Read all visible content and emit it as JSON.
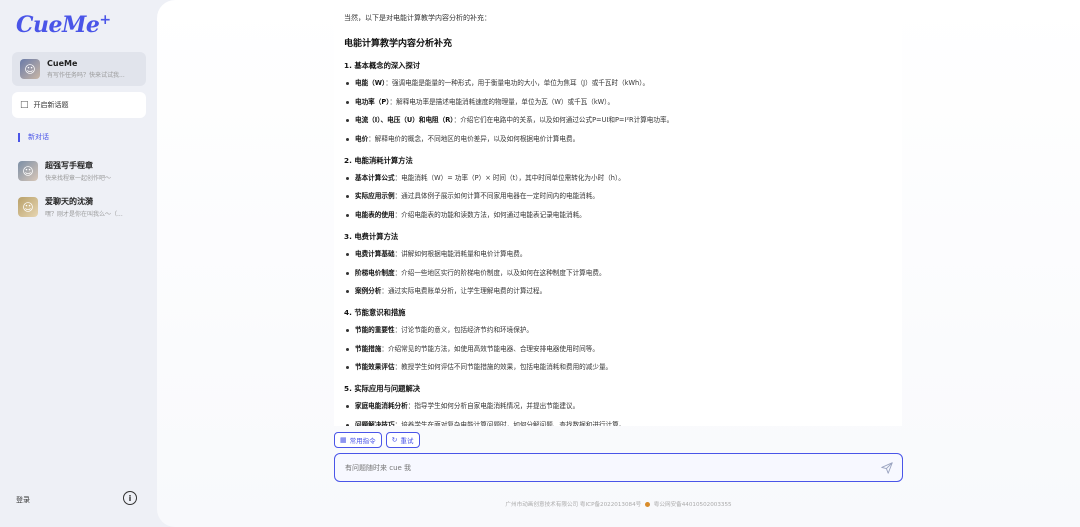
{
  "sidebar": {
    "logo": "CueMe",
    "logo_plus": "+",
    "agent": {
      "name": "CueMe",
      "subtitle": "有写作任务吗？快来试试我..."
    },
    "new_topic_label": "开启新话题",
    "active_conversation": "新对话",
    "chats": [
      {
        "name": "超强写手程章",
        "subtitle": "快来找程章一起创作吧～"
      },
      {
        "name": "爱聊天的沈漪",
        "subtitle": "嘿？刚才是你在叫我么～（..."
      }
    ],
    "login_label": "登录",
    "info_label": "i"
  },
  "content": {
    "intro": "当然，以下是对电能计算教学内容分析的补充：",
    "title": "电能计算教学内容分析补充",
    "sections": [
      {
        "heading": "1. 基本概念的深入探讨",
        "items": [
          {
            "term": "电能（W）",
            "desc": "：强调电能是能量的一种形式，用于衡量电功的大小，单位为焦耳（J）或千瓦时（kWh）。"
          },
          {
            "term": "电功率（P）",
            "desc": "：解释电功率是描述电能消耗速度的物理量，单位为瓦（W）或千瓦（kW）。"
          },
          {
            "term": "电流（I）、电压（U）和电阻（R）",
            "desc": "：介绍它们在电路中的关系，以及如何通过公式P=UI和P=I²R计算电功率。"
          },
          {
            "term": "电价",
            "desc": "：解释电价的概念，不同地区的电价差异，以及如何根据电价计算电费。"
          }
        ]
      },
      {
        "heading": "2. 电能消耗计算方法",
        "items": [
          {
            "term": "基本计算公式",
            "desc": "：电能消耗（W）= 功率（P）× 时间（t），其中时间单位需转化为小时（h）。"
          },
          {
            "term": "实际应用示例",
            "desc": "：通过具体例子展示如何计算不同家用电器在一定时间内的电能消耗。"
          },
          {
            "term": "电能表的使用",
            "desc": "：介绍电能表的功能和读数方法，如何通过电能表记录电能消耗。"
          }
        ]
      },
      {
        "heading": "3. 电费计算方法",
        "items": [
          {
            "term": "电费计算基础",
            "desc": "：讲解如何根据电能消耗量和电价计算电费。"
          },
          {
            "term": "阶梯电价制度",
            "desc": "：介绍一些地区实行的阶梯电价制度，以及如何在这种制度下计算电费。"
          },
          {
            "term": "案例分析",
            "desc": "：通过实际电费账单分析，让学生理解电费的计算过程。"
          }
        ]
      },
      {
        "heading": "4. 节能意识和措施",
        "items": [
          {
            "term": "节能的重要性",
            "desc": "：讨论节能的意义，包括经济节约和环境保护。"
          },
          {
            "term": "节能措施",
            "desc": "：介绍常见的节能方法，如使用高效节能电器、合理安排电器使用时间等。"
          },
          {
            "term": "节能效果评估",
            "desc": "：教授学生如何评估不同节能措施的效果，包括电能消耗和费用的减少量。"
          }
        ]
      },
      {
        "heading": "5. 实际应用与问题解决",
        "items": [
          {
            "term": "家庭电能消耗分析",
            "desc": "：指导学生如何分析自家电能消耗情况，并提出节能建议。"
          },
          {
            "term": "问题解决技巧",
            "desc": "：培养学生在面对复杂电能计算问题时，如何分解问题、查找数据和进行计算。"
          }
        ]
      }
    ]
  },
  "toolbar": {
    "common_commands": "常用指令",
    "retry": "重试"
  },
  "input": {
    "placeholder": "有问题随时来 cue 我"
  },
  "footer": {
    "company": "广州市动画创意技术有限公司 粤ICP备2022013084号",
    "police": "粤公网安备44010502003355"
  },
  "colors": {
    "accent": "#4a55e8"
  }
}
